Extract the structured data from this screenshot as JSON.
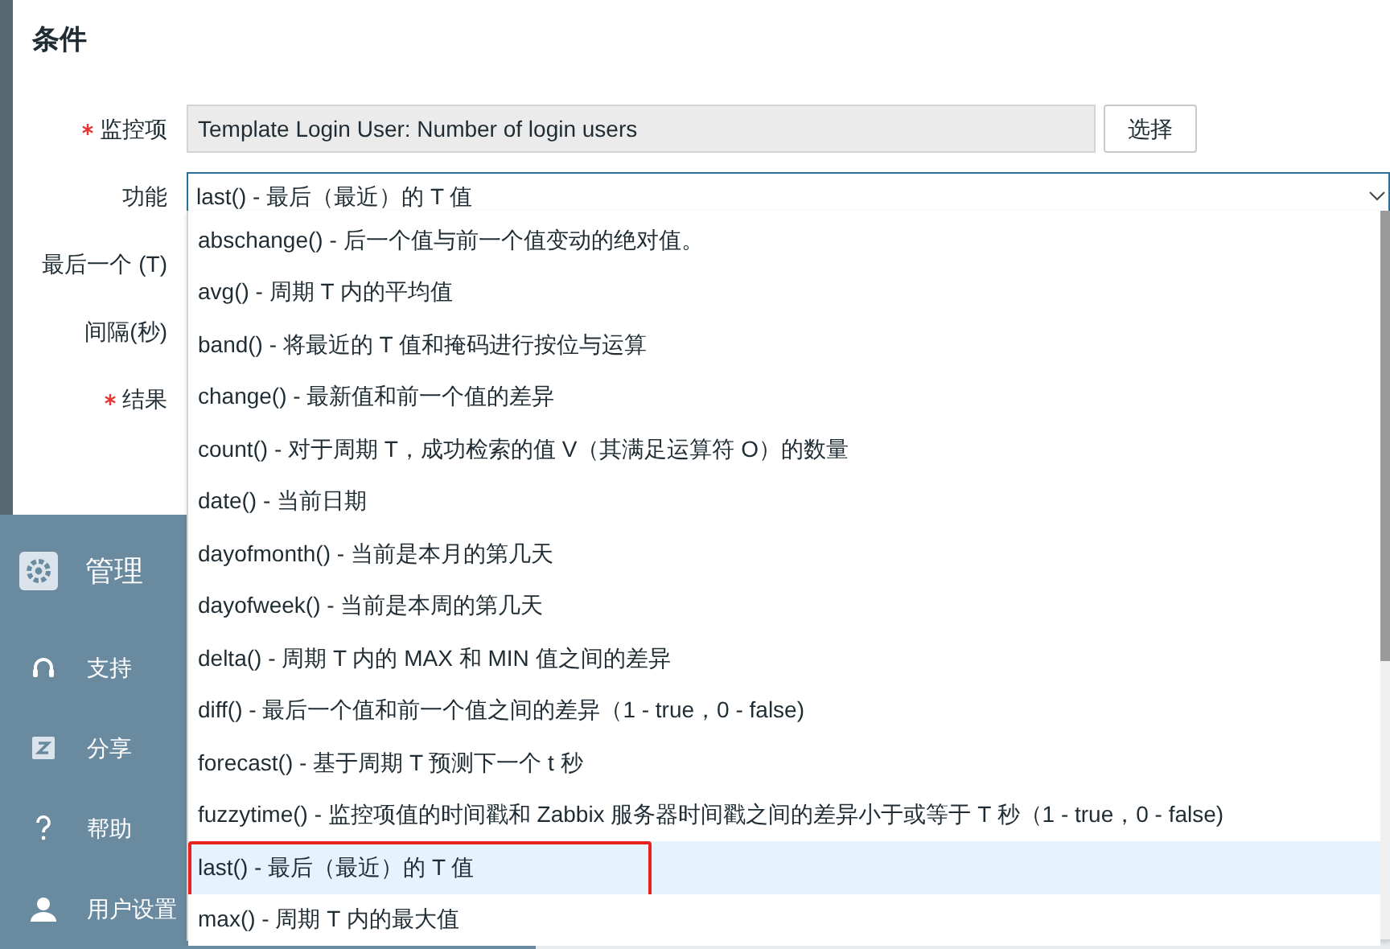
{
  "sidebar": {
    "section": {
      "label": "管理",
      "kind": "gear"
    },
    "items": [
      {
        "label": "支持",
        "kind": "headset"
      },
      {
        "label": "分享",
        "kind": "z"
      },
      {
        "label": "帮助",
        "kind": "question"
      },
      {
        "label": "用户设置",
        "kind": "user"
      }
    ]
  },
  "dialog": {
    "title": "条件",
    "fields": [
      {
        "label": "监控项",
        "required": true,
        "value": "Template Login User: Number of login users",
        "button": "选择"
      },
      {
        "label": "功能",
        "required": false,
        "value": "last() - 最后（最近）的 T 值"
      },
      {
        "label": "最后一个 (T)",
        "required": false
      },
      {
        "label": "间隔(秒)",
        "required": false
      },
      {
        "label": "结果",
        "required": true
      }
    ]
  },
  "dropdown": {
    "expanded": true,
    "options": [
      {
        "label": "abschange() - 后一个值与前一个值变动的绝对值。",
        "selected": false,
        "marked": false
      },
      {
        "label": "avg() - 周期 T 内的平均值",
        "selected": false,
        "marked": false
      },
      {
        "label": "band() - 将最近的 T 值和掩码进行按位与运算",
        "selected": false,
        "marked": false
      },
      {
        "label": "change() - 最新值和前一个值的差异",
        "selected": false,
        "marked": false
      },
      {
        "label": "count() - 对于周期 T，成功检索的值 V（其满足运算符 O）的数量",
        "selected": false,
        "marked": false
      },
      {
        "label": "date() - 当前日期",
        "selected": false,
        "marked": false
      },
      {
        "label": "dayofmonth() - 当前是本月的第几天",
        "selected": false,
        "marked": false
      },
      {
        "label": "dayofweek() - 当前是本周的第几天",
        "selected": false,
        "marked": false
      },
      {
        "label": "delta() - 周期 T 内的 MAX 和 MIN 值之间的差异",
        "selected": false,
        "marked": false
      },
      {
        "label": "diff() - 最后一个值和前一个值之间的差异（1 - true，0 - false)",
        "selected": false,
        "marked": false
      },
      {
        "label": "forecast() - 基于周期 T 预测下一个 t 秒",
        "selected": false,
        "marked": false
      },
      {
        "label": "fuzzytime() - 监控项值的时间戳和 Zabbix 服务器时间戳之间的差异小于或等于 T 秒（1 - true，0 - false)",
        "selected": false,
        "marked": false
      },
      {
        "label": "last() - 最后（最近）的 T 值",
        "selected": true,
        "marked": true
      },
      {
        "label": "max() - 周期 T 内的最大值",
        "selected": false,
        "marked": false
      }
    ]
  }
}
